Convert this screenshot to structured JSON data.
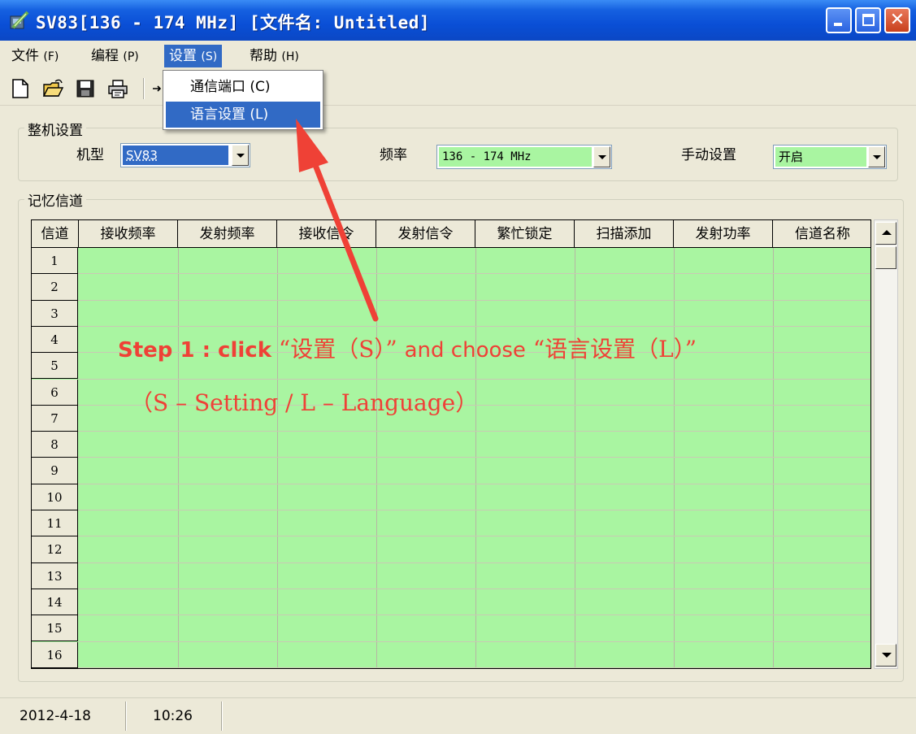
{
  "window": {
    "title": "SV83[136 - 174 MHz] [文件名: Untitled]"
  },
  "menubar": {
    "items": [
      {
        "label": "文件",
        "accel": "(F)"
      },
      {
        "label": "编程",
        "accel": "(P)"
      },
      {
        "label": "设置",
        "accel": "(S)"
      },
      {
        "label": "帮助",
        "accel": "(H)"
      }
    ]
  },
  "dropdown": {
    "items": [
      {
        "label": "通信端口",
        "accel": "(C)"
      },
      {
        "label": "语言设置",
        "accel": "(L)"
      }
    ]
  },
  "device_settings": {
    "group_title": "整机设置",
    "model_label": "机型",
    "model_value": "SV83",
    "freq_label": "频率",
    "freq_value": "136 - 174 MHz",
    "manual_label": "手动设置",
    "manual_value": "开启"
  },
  "memory": {
    "group_title": "记忆信道",
    "columns": [
      "信道",
      "接收频率",
      "发射频率",
      "接收信令",
      "发射信令",
      "繁忙锁定",
      "扫描添加",
      "发射功率",
      "信道名称"
    ],
    "rows": [
      "1",
      "2",
      "3",
      "4",
      "5",
      "6",
      "7",
      "8",
      "9",
      "10",
      "11",
      "12",
      "13",
      "14",
      "15",
      "16"
    ]
  },
  "annotation": {
    "step_label": "Step 1 : click",
    "quote_setting": "“设置（S）”",
    "choose_text": "and choose",
    "quote_language": "“语言设置（L）”",
    "line2": "（S – Setting / L – Language）",
    "color": "#ef4136"
  },
  "statusbar": {
    "date": "2012-4-18",
    "time": "10:26"
  },
  "colors": {
    "grid_fill": "#a9f5a1",
    "combo_fill": "#a9f5a1",
    "highlight": "#316ac5",
    "titlebar": "#0a4fd6"
  },
  "icons": [
    "app-icon",
    "new-file-icon",
    "open-folder-icon",
    "save-icon",
    "print-icon",
    "minimize-icon",
    "maximize-icon",
    "close-icon",
    "dropdown-arrow-icon",
    "scroll-up-icon",
    "scroll-down-icon",
    "red-arrow-icon"
  ]
}
